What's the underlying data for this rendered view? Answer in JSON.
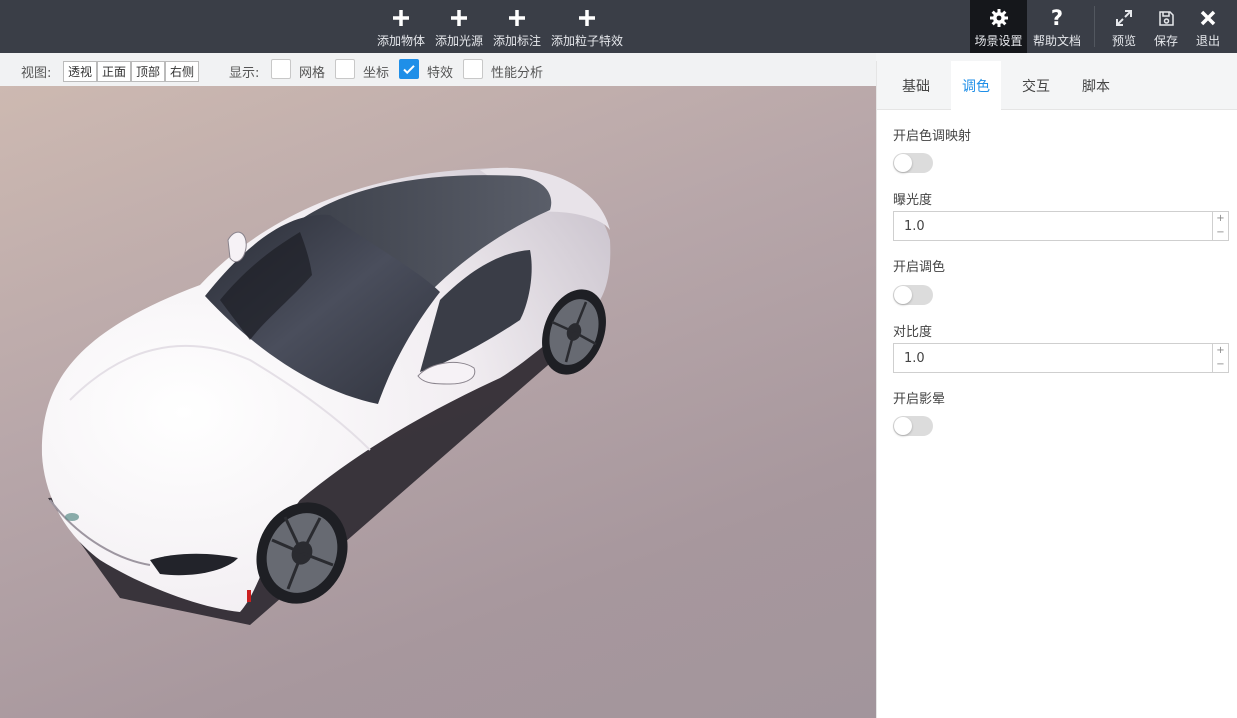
{
  "toolbar": {
    "add_object": "添加物体",
    "add_light": "添加光源",
    "add_annotation": "添加标注",
    "add_particle": "添加粒子特效",
    "scene_settings": "场景设置",
    "help": "帮助文档",
    "preview": "预览",
    "save": "保存",
    "exit": "退出"
  },
  "viewbar": {
    "view_label": "视图:",
    "views": [
      "透视",
      "正面",
      "顶部",
      "右侧"
    ],
    "display_label": "显示:",
    "options": [
      {
        "label": "网格",
        "checked": false
      },
      {
        "label": "坐标",
        "checked": false
      },
      {
        "label": "特效",
        "checked": true
      },
      {
        "label": "性能分析",
        "checked": false
      }
    ]
  },
  "panel": {
    "tabs": [
      "基础",
      "调色",
      "交互",
      "脚本"
    ],
    "active_tab": "调色",
    "tone_mapping_label": "开启色调映射",
    "tone_mapping_on": false,
    "exposure_label": "曝光度",
    "exposure_value": "1.0",
    "color_grading_label": "开启调色",
    "color_grading_on": false,
    "contrast_label": "对比度",
    "contrast_value": "1.0",
    "vignette_label": "开启影晕",
    "vignette_on": false,
    "stepper_up": "+",
    "stepper_down": "−"
  },
  "colors": {
    "toolbar_bg": "#3a3e47",
    "active_tool_bg": "#15171b",
    "accent": "#1f8fe8",
    "car_body": "#f1ecf0"
  }
}
